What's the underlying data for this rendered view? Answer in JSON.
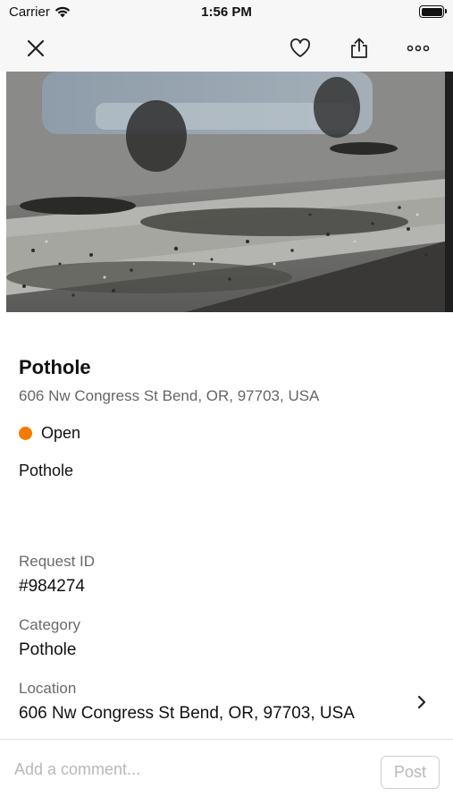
{
  "status_bar": {
    "carrier": "Carrier",
    "time": "1:56 PM",
    "icons": [
      "wifi-icon",
      "battery-icon"
    ]
  },
  "nav": {
    "close_icon": "close-icon",
    "favorite_icon": "heart-icon",
    "share_icon": "share-icon",
    "more_icon": "more-icon"
  },
  "hero": {
    "image": "pothole-photo"
  },
  "request": {
    "title": "Pothole",
    "address": "606 Nw Congress St Bend, OR, 97703, USA",
    "status": {
      "label": "Open",
      "color": "#f57c00"
    },
    "description": "Pothole"
  },
  "fields": {
    "request_id": {
      "label": "Request ID",
      "value": "#984274"
    },
    "category": {
      "label": "Category",
      "value": "Pothole"
    },
    "location": {
      "label": "Location",
      "value": "606 Nw Congress St Bend, OR, 97703, USA"
    }
  },
  "comment": {
    "placeholder": "Add a comment...",
    "post_label": "Post"
  }
}
